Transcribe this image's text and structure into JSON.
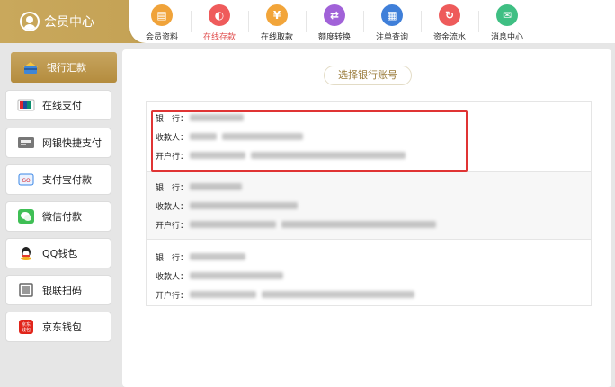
{
  "header": {
    "title": "会员中心",
    "nav": [
      {
        "label": "会员资料",
        "icon": "id-card-icon",
        "color": "#f0a33a",
        "glyph": "▤"
      },
      {
        "label": "在线存款",
        "icon": "piggy-bank-icon",
        "color": "#ef5b5b",
        "glyph": "◐",
        "active": true
      },
      {
        "label": "在线取款",
        "icon": "yen-icon",
        "color": "#f2a53a",
        "glyph": "¥"
      },
      {
        "label": "额度转换",
        "icon": "transfer-icon",
        "color": "#a162d8",
        "glyph": "⇄"
      },
      {
        "label": "注单查询",
        "icon": "document-icon",
        "color": "#3f7fd9",
        "glyph": "▦"
      },
      {
        "label": "资金流水",
        "icon": "cycle-icon",
        "color": "#ee5b5b",
        "glyph": "↻"
      },
      {
        "label": "消息中心",
        "icon": "mail-icon",
        "color": "#3fbf83",
        "glyph": "✉"
      }
    ],
    "accent": "#e14f4f",
    "brand_color": "#b99545"
  },
  "sidebar": {
    "items": [
      {
        "label": "银行汇款",
        "icon": "bank-card-icon",
        "active": true
      },
      {
        "label": "在线支付",
        "icon": "unionpay-icon"
      },
      {
        "label": "网银快捷支付",
        "icon": "card-reader-icon"
      },
      {
        "label": "支付宝付款",
        "icon": "alipay-icon"
      },
      {
        "label": "微信付款",
        "icon": "wechat-icon"
      },
      {
        "label": "QQ钱包",
        "icon": "qq-penguin-icon"
      },
      {
        "label": "银联扫码",
        "icon": "scan-icon"
      },
      {
        "label": "京东钱包",
        "icon": "jd-wallet-icon"
      }
    ]
  },
  "main": {
    "select_title": "选择银行账号",
    "field_labels": {
      "bank": "银　行：",
      "payee": "收款人：",
      "branch": "开户行："
    },
    "selected_index": 0,
    "highlight_color": "#e03434"
  }
}
